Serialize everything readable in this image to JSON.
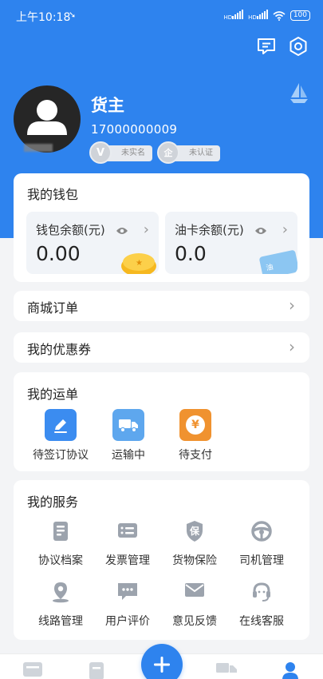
{
  "status_bar": {
    "time": "上午10:18",
    "net_a": "HD",
    "net_b": "HD",
    "battery": "100"
  },
  "profile": {
    "name": "货主",
    "phone": "17000000009",
    "badge_realname": "未实名",
    "badge_realname_icon": "V",
    "badge_cert": "未认证",
    "badge_cert_icon": "企"
  },
  "wallet": {
    "title": "我的钱包",
    "balance_label": "钱包余额(元)",
    "balance_value": "0.00",
    "fuel_label": "油卡余额(元)",
    "fuel_value": "0.0",
    "fuel_card_glyph": "油"
  },
  "mall_orders": {
    "label": "商城订单"
  },
  "coupons": {
    "label": "我的优惠券"
  },
  "waybills": {
    "title": "我的运单",
    "items": [
      {
        "label": "待签订协议",
        "icon": "pen-icon",
        "color": "#3b8cf0"
      },
      {
        "label": "运输中",
        "icon": "truck-icon",
        "color": "#5ea7ee"
      },
      {
        "label": "待支付",
        "icon": "yen-icon",
        "color": "#f0922f",
        "glyph": "¥"
      }
    ]
  },
  "services": {
    "title": "我的服务",
    "items": [
      {
        "label": "协议档案",
        "icon": "file-icon"
      },
      {
        "label": "发票管理",
        "icon": "invoice-icon"
      },
      {
        "label": "货物保险",
        "icon": "insurance-icon",
        "glyph": "保"
      },
      {
        "label": "司机管理",
        "icon": "steering-wheel-icon"
      },
      {
        "label": "线路管理",
        "icon": "route-pin-icon"
      },
      {
        "label": "用户评价",
        "icon": "comment-icon"
      },
      {
        "label": "意见反馈",
        "icon": "mail-icon"
      },
      {
        "label": "在线客服",
        "icon": "headset-icon"
      }
    ]
  },
  "colors": {
    "primary": "#2e83ee",
    "icon_gray": "#9ca3ad",
    "background": "#f3f4f6"
  }
}
